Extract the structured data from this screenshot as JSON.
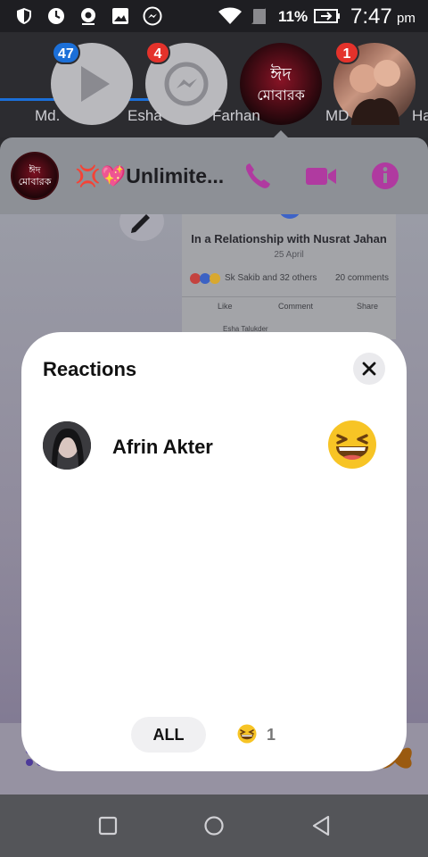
{
  "status_bar": {
    "battery_percent": "11%",
    "time": "7:47",
    "ampm": "pm",
    "icons": [
      "shield-icon",
      "clock-icon",
      "location-icon",
      "image-icon",
      "messenger-icon",
      "wifi-icon",
      "signal-icon",
      "battery-icon"
    ]
  },
  "chat_heads": [
    {
      "name": "Md.",
      "badge": "47",
      "badge_color": "#1b6fd8"
    },
    {
      "name": "Esha",
      "badge": "4",
      "badge_color": "#e4322b"
    },
    {
      "name": "Farhan",
      "badge": "",
      "badge_color": ""
    },
    {
      "name": "MD",
      "badge": "1",
      "badge_color": "#e4322b"
    },
    {
      "name": "Ha",
      "badge": "",
      "badge_color": ""
    }
  ],
  "conversation": {
    "title": "💢💖Unlimite...",
    "avatar_text": "ঈদ মোবারক",
    "accent_color": "#b03aa0"
  },
  "background_post": {
    "title": "In a Relationship with Nusrat Jahan",
    "date": "25 April",
    "reactions_text": "Sk Sakib and 32 others",
    "comments_text": "20 comments",
    "like_label": "Like",
    "comment_label": "Comment",
    "share_label": "Share",
    "commenter": "Esha Talukder"
  },
  "reactions_sheet": {
    "title": "Reactions",
    "reactors": [
      {
        "name": "Afrin Akter",
        "reaction": "laughing-emoji"
      }
    ],
    "filters": {
      "all_label": "ALL",
      "laugh_count": "1"
    }
  },
  "nav_bar": {
    "buttons": [
      "recent-apps-button",
      "home-button",
      "back-button"
    ]
  }
}
